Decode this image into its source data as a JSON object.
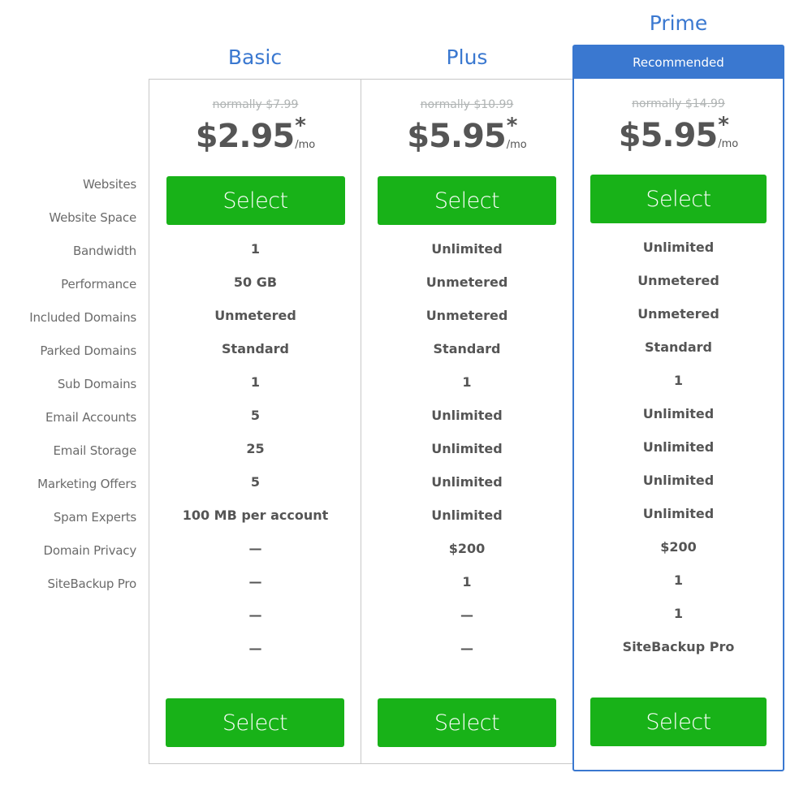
{
  "feature_labels": [
    "Websites",
    "Website Space",
    "Bandwidth",
    "Performance",
    "Included Domains",
    "Parked Domains",
    "Sub Domains",
    "Email Accounts",
    "Email Storage",
    "Marketing Offers",
    "Spam Experts",
    "Domain Privacy",
    "SiteBackup Pro"
  ],
  "colors": {
    "accent_blue": "#3a78d0",
    "select_green": "#18b218",
    "text_dark": "#555555",
    "text_muted": "#b0b4b4"
  },
  "plans": [
    {
      "name": "Basic",
      "normally": "normally $7.99",
      "price": "$2.95",
      "asterisk": "*",
      "per": "/mo",
      "select_label": "Select",
      "values": [
        "1",
        "50 GB",
        "Unmetered",
        "Standard",
        "1",
        "5",
        "25",
        "5",
        "100 MB per account",
        "—",
        "—",
        "—",
        "—"
      ]
    },
    {
      "name": "Plus",
      "normally": "normally $10.99",
      "price": "$5.95",
      "asterisk": "*",
      "per": "/mo",
      "select_label": "Select",
      "values": [
        "Unlimited",
        "Unmetered",
        "Unmetered",
        "Standard",
        "1",
        "Unlimited",
        "Unlimited",
        "Unlimited",
        "Unlimited",
        "$200",
        "1",
        "—",
        "—"
      ]
    },
    {
      "name": "Prime",
      "badge": "Recommended",
      "normally": "normally $14.99",
      "price": "$5.95",
      "asterisk": "*",
      "per": "/mo",
      "select_label": "Select",
      "values": [
        "Unlimited",
        "Unmetered",
        "Unmetered",
        "Standard",
        "1",
        "Unlimited",
        "Unlimited",
        "Unlimited",
        "Unlimited",
        "$200",
        "1",
        "1",
        "SiteBackup Pro"
      ]
    }
  ]
}
